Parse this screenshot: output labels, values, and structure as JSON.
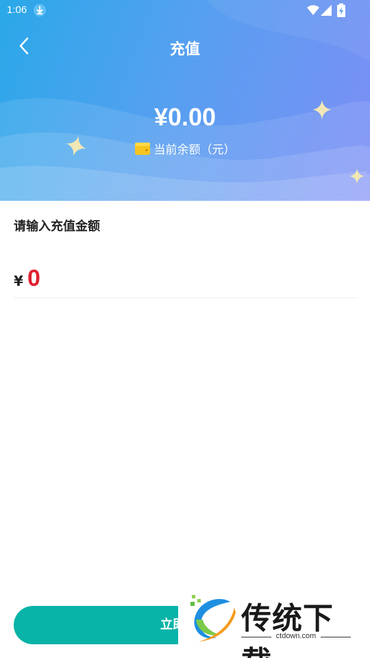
{
  "status_bar": {
    "time": "1:06",
    "icons": [
      "download-icon",
      "wifi-icon",
      "signal-icon",
      "battery-charging-icon"
    ]
  },
  "header": {
    "back_icon": "chevron-left-icon",
    "title": "充值",
    "balance": "¥0.00",
    "balance_label": "当前余额（元）",
    "wallet_icon": "wallet-icon",
    "gradient": [
      "#2aa8e8",
      "#7e8ef5"
    ]
  },
  "form": {
    "section_title": "请输入充值金额",
    "currency": "¥",
    "amount_value": "0",
    "amount_color": "#e02030"
  },
  "submit": {
    "label": "立即充值",
    "color": "#08b3a7"
  },
  "watermark": {
    "brand": "传统下载",
    "url": "ctdown.com"
  }
}
